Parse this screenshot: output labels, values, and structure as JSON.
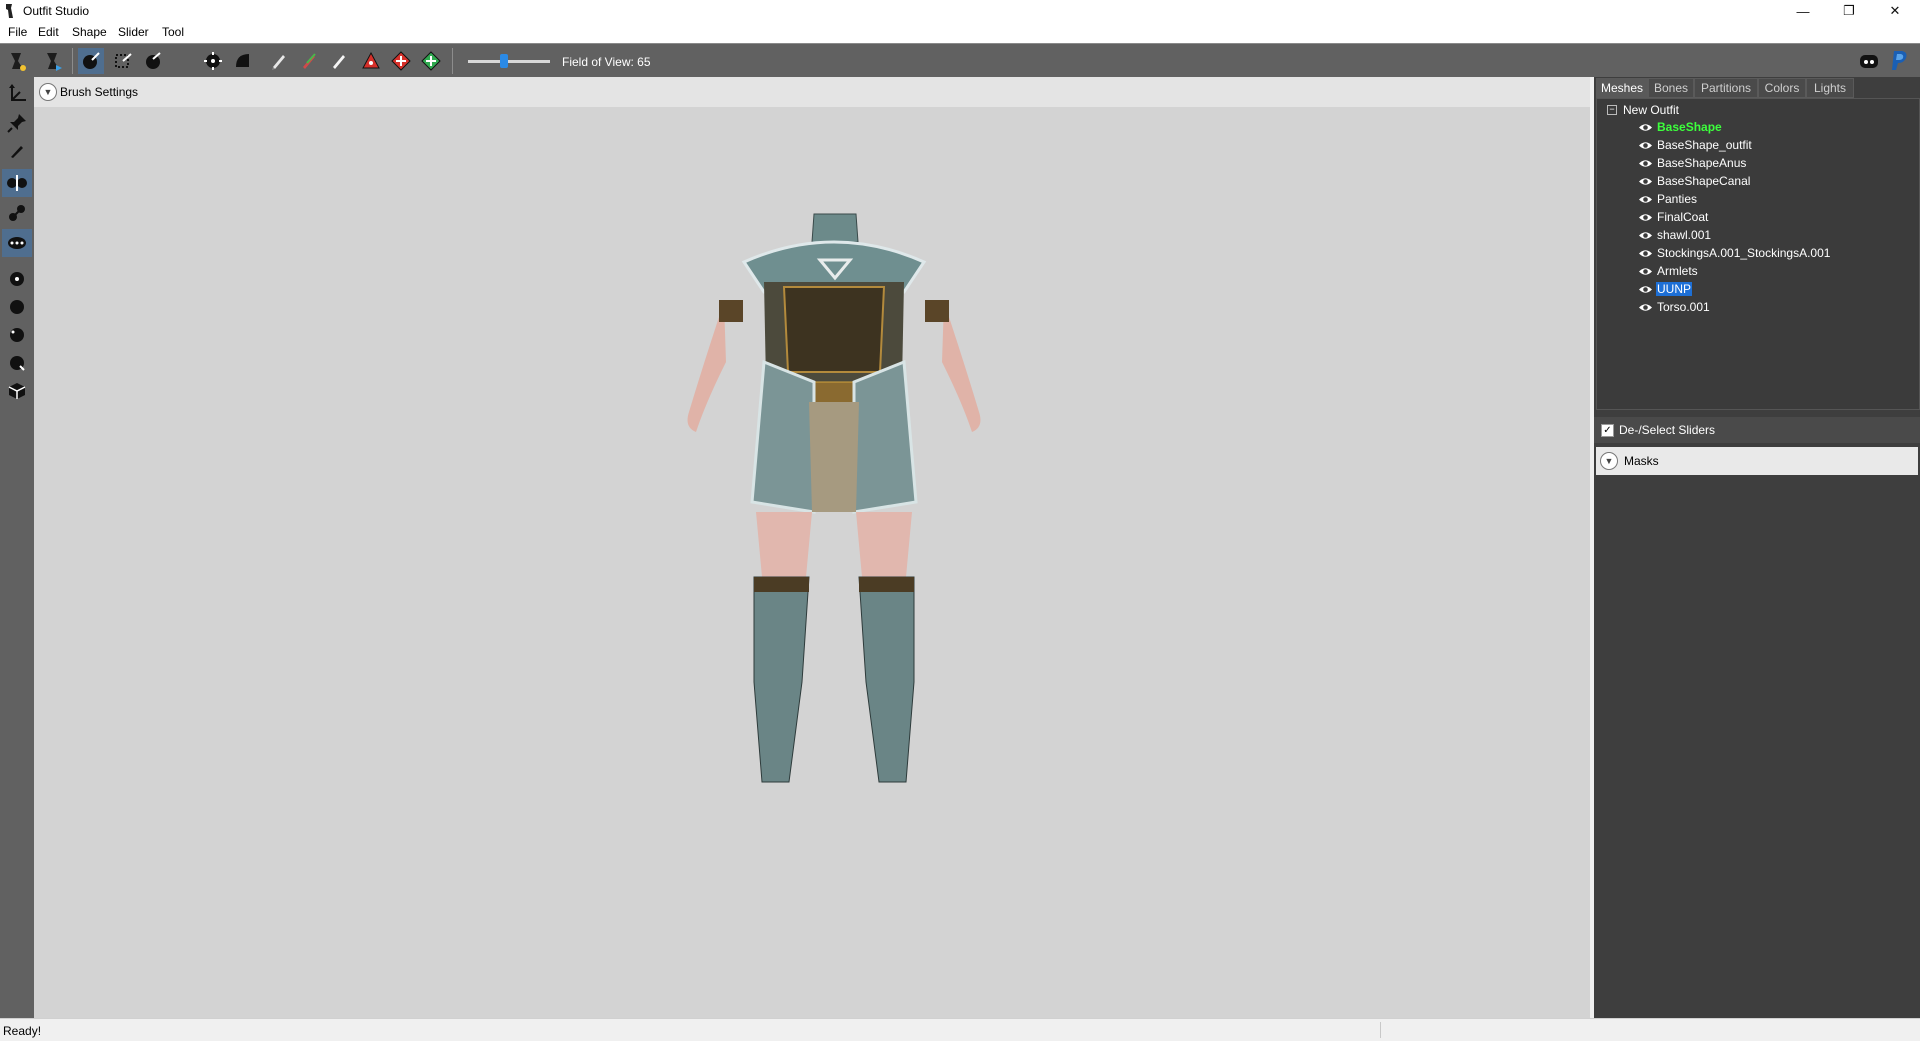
{
  "window": {
    "title": "Outfit Studio",
    "minimize": "—",
    "restore": "❐",
    "close": "✕"
  },
  "menu": [
    "File",
    "Edit",
    "Shape",
    "Slider",
    "Tool"
  ],
  "toolbar": {
    "fov_label": "Field of View: 65",
    "fov_value": 65
  },
  "viewport": {
    "brush_settings_label": "Brush Settings"
  },
  "panel": {
    "tabs": [
      "Meshes",
      "Bones",
      "Partitions",
      "Colors",
      "Lights"
    ],
    "active_tab": "Meshes",
    "tree": {
      "collapse_symbol": "−",
      "root": "New Outfit",
      "shapes": [
        "BaseShape",
        "BaseShape_outfit",
        "BaseShapeAnus",
        "BaseShapeCanal",
        "Panties",
        "FinalCoat",
        "shawl.001",
        "StockingsA.001_StockingsA.001",
        "Armlets",
        "UUNP",
        "Torso.001"
      ],
      "green_shape": "BaseShape",
      "selected_shape": "UUNP"
    },
    "deselect_check": "✓",
    "deselect_label": "De-/Select Sliders",
    "masks_label": "Masks"
  },
  "status": {
    "text": "Ready!"
  },
  "colors": {
    "toolbar_bg": "#616161",
    "viewport_bg": "#d3d3d3",
    "panel_bg": "#3e3e3e",
    "active_tool": "#4f6e8f",
    "selection": "#1d6fd6",
    "green_text": "#3cff3c"
  }
}
